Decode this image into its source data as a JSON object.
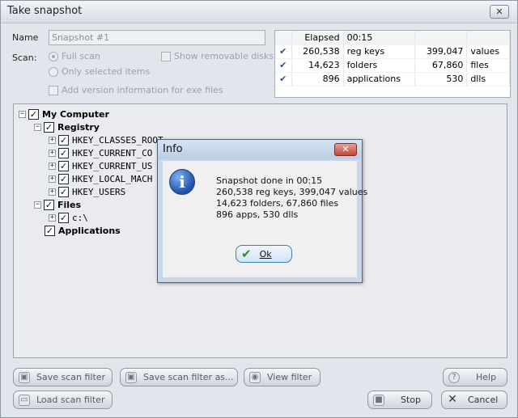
{
  "window": {
    "title": "Take snapshot"
  },
  "form": {
    "name_label": "Name",
    "name_value": "Snapshot #1",
    "scan_label": "Scan:",
    "full_scan": "Full scan",
    "only_selected": "Only selected items",
    "show_removable": "Show removable disks",
    "add_version": "Add version information for exe files"
  },
  "stats": {
    "elapsed_label": "Elapsed",
    "elapsed_value": "00:15",
    "rows": [
      {
        "check": "✔",
        "n1": "260,538",
        "l1": "reg keys",
        "n2": "399,047",
        "l2": "values"
      },
      {
        "check": "✔",
        "n1": "14,623",
        "l1": "folders",
        "n2": "67,860",
        "l2": "files"
      },
      {
        "check": "✔",
        "n1": "896",
        "l1": "applications",
        "n2": "530",
        "l2": "dlls"
      }
    ]
  },
  "tree": {
    "root": "My Computer",
    "registry": "Registry",
    "keys": [
      "HKEY_CLASSES_ROOT",
      "HKEY_CURRENT_CO",
      "HKEY_CURRENT_US",
      "HKEY_LOCAL_MACH",
      "HKEY_USERS"
    ],
    "files": "Files",
    "drive": "c:\\",
    "applications": "Applications"
  },
  "buttons": {
    "save_filter": "Save scan filter",
    "save_filter_as": "Save scan filter as...",
    "view_filter": "View filter",
    "help": "Help",
    "load_filter": "Load scan filter",
    "stop": "Stop",
    "cancel": "Cancel"
  },
  "dialog": {
    "title": "Info",
    "lines": [
      "Snapshot done in 00:15",
      "260,538 reg keys, 399,047 values",
      "14,623 folders, 67,860 files",
      "896 apps, 530 dlls"
    ],
    "ok": "Ok"
  },
  "colors": {
    "accent": "#2d4f8e",
    "dialog_frame": "#c9d7e9",
    "close_red": "#c3463a"
  }
}
